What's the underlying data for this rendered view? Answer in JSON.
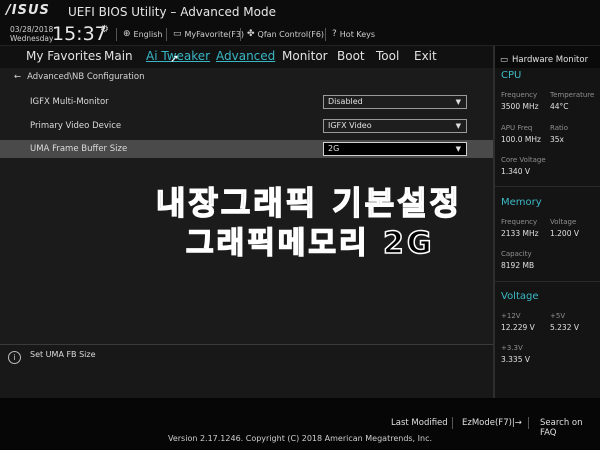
{
  "titlebar": {
    "logo": "/ISUS",
    "title": "UEFI BIOS Utility – Advanced Mode"
  },
  "status": {
    "date": "03/28/2018",
    "day": "Wednesday",
    "time": "15:37",
    "language": "English",
    "myfavorite": "MyFavorite(F3)",
    "qfan": "Qfan Control(F6)",
    "hotkeys": "Hot Keys"
  },
  "menu": {
    "items": [
      "My Favorites",
      "Main",
      "Ai Tweaker",
      "Advanced",
      "Monitor",
      "Boot",
      "Tool",
      "Exit"
    ]
  },
  "main": {
    "breadcrumb": "Advanced\\NB Configuration",
    "rows": [
      {
        "label": "IGFX Multi-Monitor",
        "value": "Disabled"
      },
      {
        "label": "Primary Video Device",
        "value": "IGFX Video"
      },
      {
        "label": "UMA Frame Buffer Size",
        "value": "2G"
      }
    ],
    "overlay_line1": "내장그래픽 기본설정",
    "overlay_line2": "그래픽메모리 2G"
  },
  "info": {
    "text": "Set UMA FB Size"
  },
  "hwmon": {
    "title": "Hardware Monitor",
    "cpu": {
      "section": "CPU",
      "frequency_label": "Frequency",
      "frequency": "3500 MHz",
      "temperature_label": "Temperature",
      "temperature": "44°C",
      "apu_label": "APU Freq",
      "apu": "100.0 MHz",
      "ratio_label": "Ratio",
      "ratio": "35x",
      "core_voltage_label": "Core Voltage",
      "core_voltage": "1.340 V"
    },
    "memory": {
      "section": "Memory",
      "frequency_label": "Frequency",
      "frequency": "2133 MHz",
      "voltage_label": "Voltage",
      "voltage": "1.200 V",
      "capacity_label": "Capacity",
      "capacity": "8192 MB"
    },
    "voltage": {
      "section": "Voltage",
      "v12_label": "+12V",
      "v12": "12.229 V",
      "v5_label": "+5V",
      "v5": "5.232 V",
      "v33_label": "+3.3V",
      "v33": "3.335 V"
    }
  },
  "bottom": {
    "last_modified": "Last Modified",
    "ezmode": "EzMode(F7)|→",
    "search": "Search on FAQ",
    "version": "Version 2.17.1246. Copyright (C) 2018 American Megatrends, Inc."
  },
  "colors": {
    "accent": "#38b6c4",
    "background": "#1b1b1b",
    "selected_row": "#4a4a4a"
  }
}
